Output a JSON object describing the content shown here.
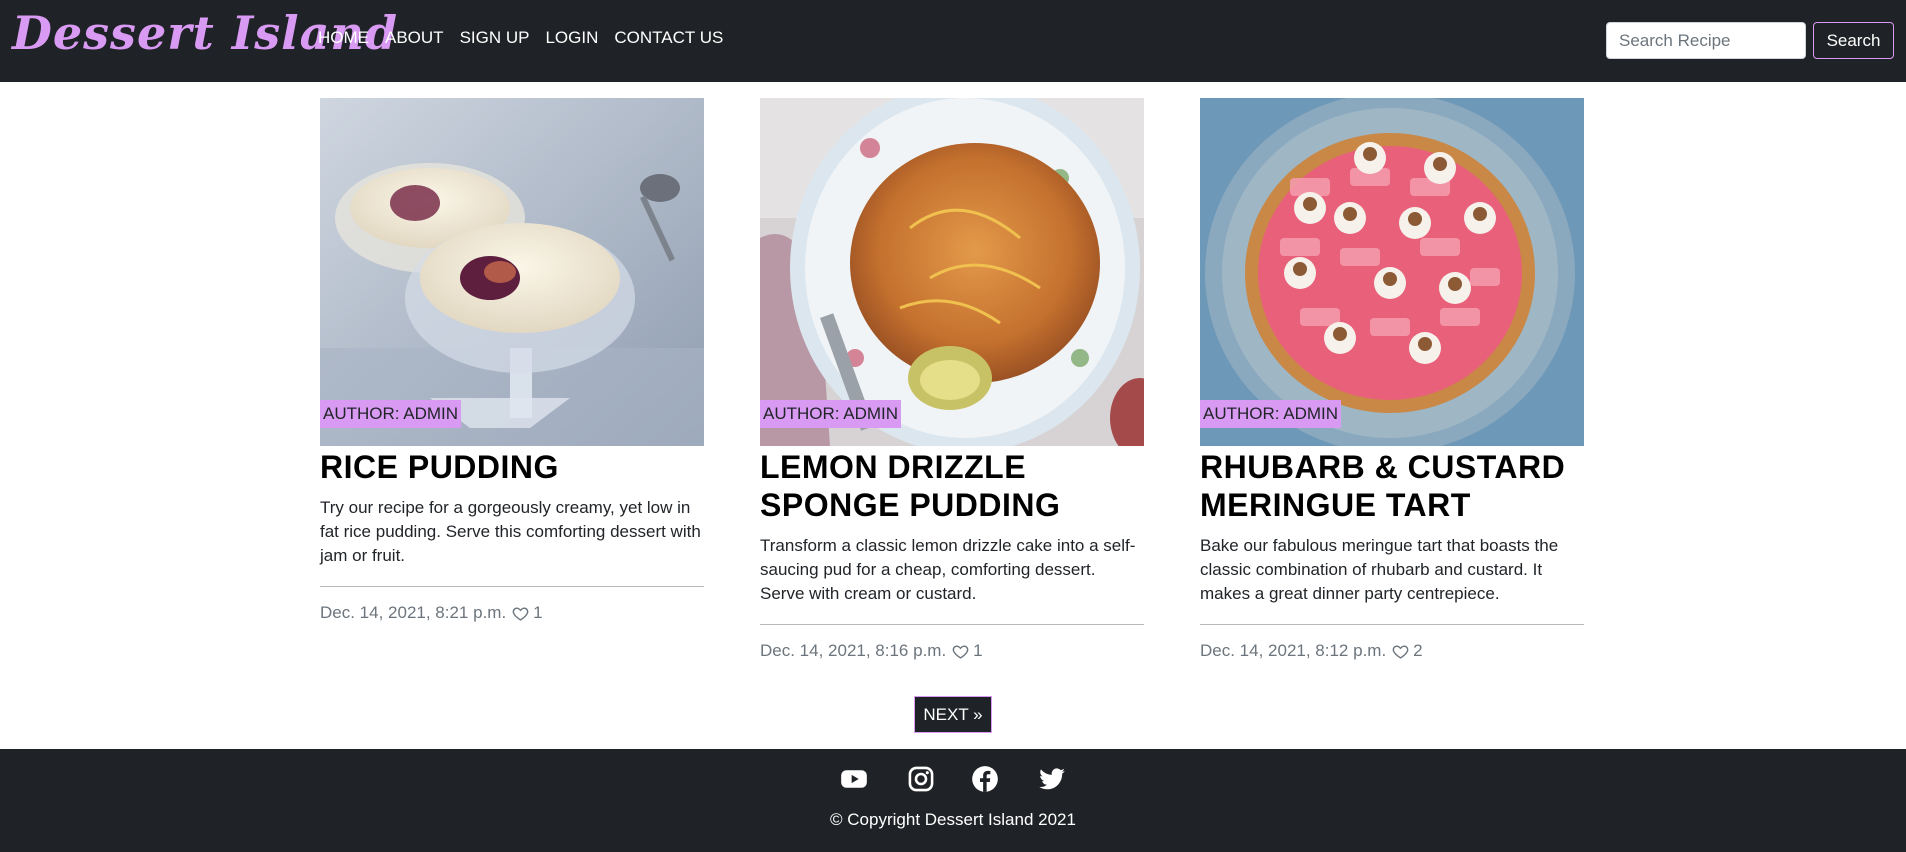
{
  "brand": {
    "name": "Dessert Island",
    "accent_color": "#d89af2"
  },
  "nav": {
    "items": [
      {
        "label": "HOME"
      },
      {
        "label": "ABOUT"
      },
      {
        "label": "SIGN UP"
      },
      {
        "label": "LOGIN"
      },
      {
        "label": "CONTACT US"
      }
    ]
  },
  "search": {
    "placeholder": "Search Recipe",
    "value": "",
    "button_label": "Search"
  },
  "recipes": [
    {
      "author": "AUTHOR: ADMIN",
      "title": "RICE PUDDING",
      "description": "Try our recipe for a gorgeously creamy, yet low in fat rice pudding. Serve this comforting dessert with jam or fruit.",
      "date": "Dec. 14, 2021, 8:21 p.m.",
      "likes": "1"
    },
    {
      "author": "AUTHOR: ADMIN",
      "title": "LEMON DRIZZLE SPONGE PUDDING",
      "description": "Transform a classic lemon drizzle cake into a self-saucing pud for a cheap, comforting dessert. Serve with cream or custard.",
      "date": "Dec. 14, 2021, 8:16 p.m.",
      "likes": "1"
    },
    {
      "author": "AUTHOR: ADMIN",
      "title": "RHUBARB & CUSTARD MERINGUE TART",
      "description": "Bake our fabulous meringue tart that boasts the classic combination of rhubarb and custard. It makes a great dinner party centrepiece.",
      "date": "Dec. 14, 2021, 8:12 p.m.",
      "likes": "2"
    }
  ],
  "pagination": {
    "next_label": "NEXT »"
  },
  "footer": {
    "social_icons": [
      "youtube-icon",
      "instagram-icon",
      "facebook-icon",
      "twitter-icon"
    ],
    "copyright": "© Copyright Dessert Island 2021"
  }
}
